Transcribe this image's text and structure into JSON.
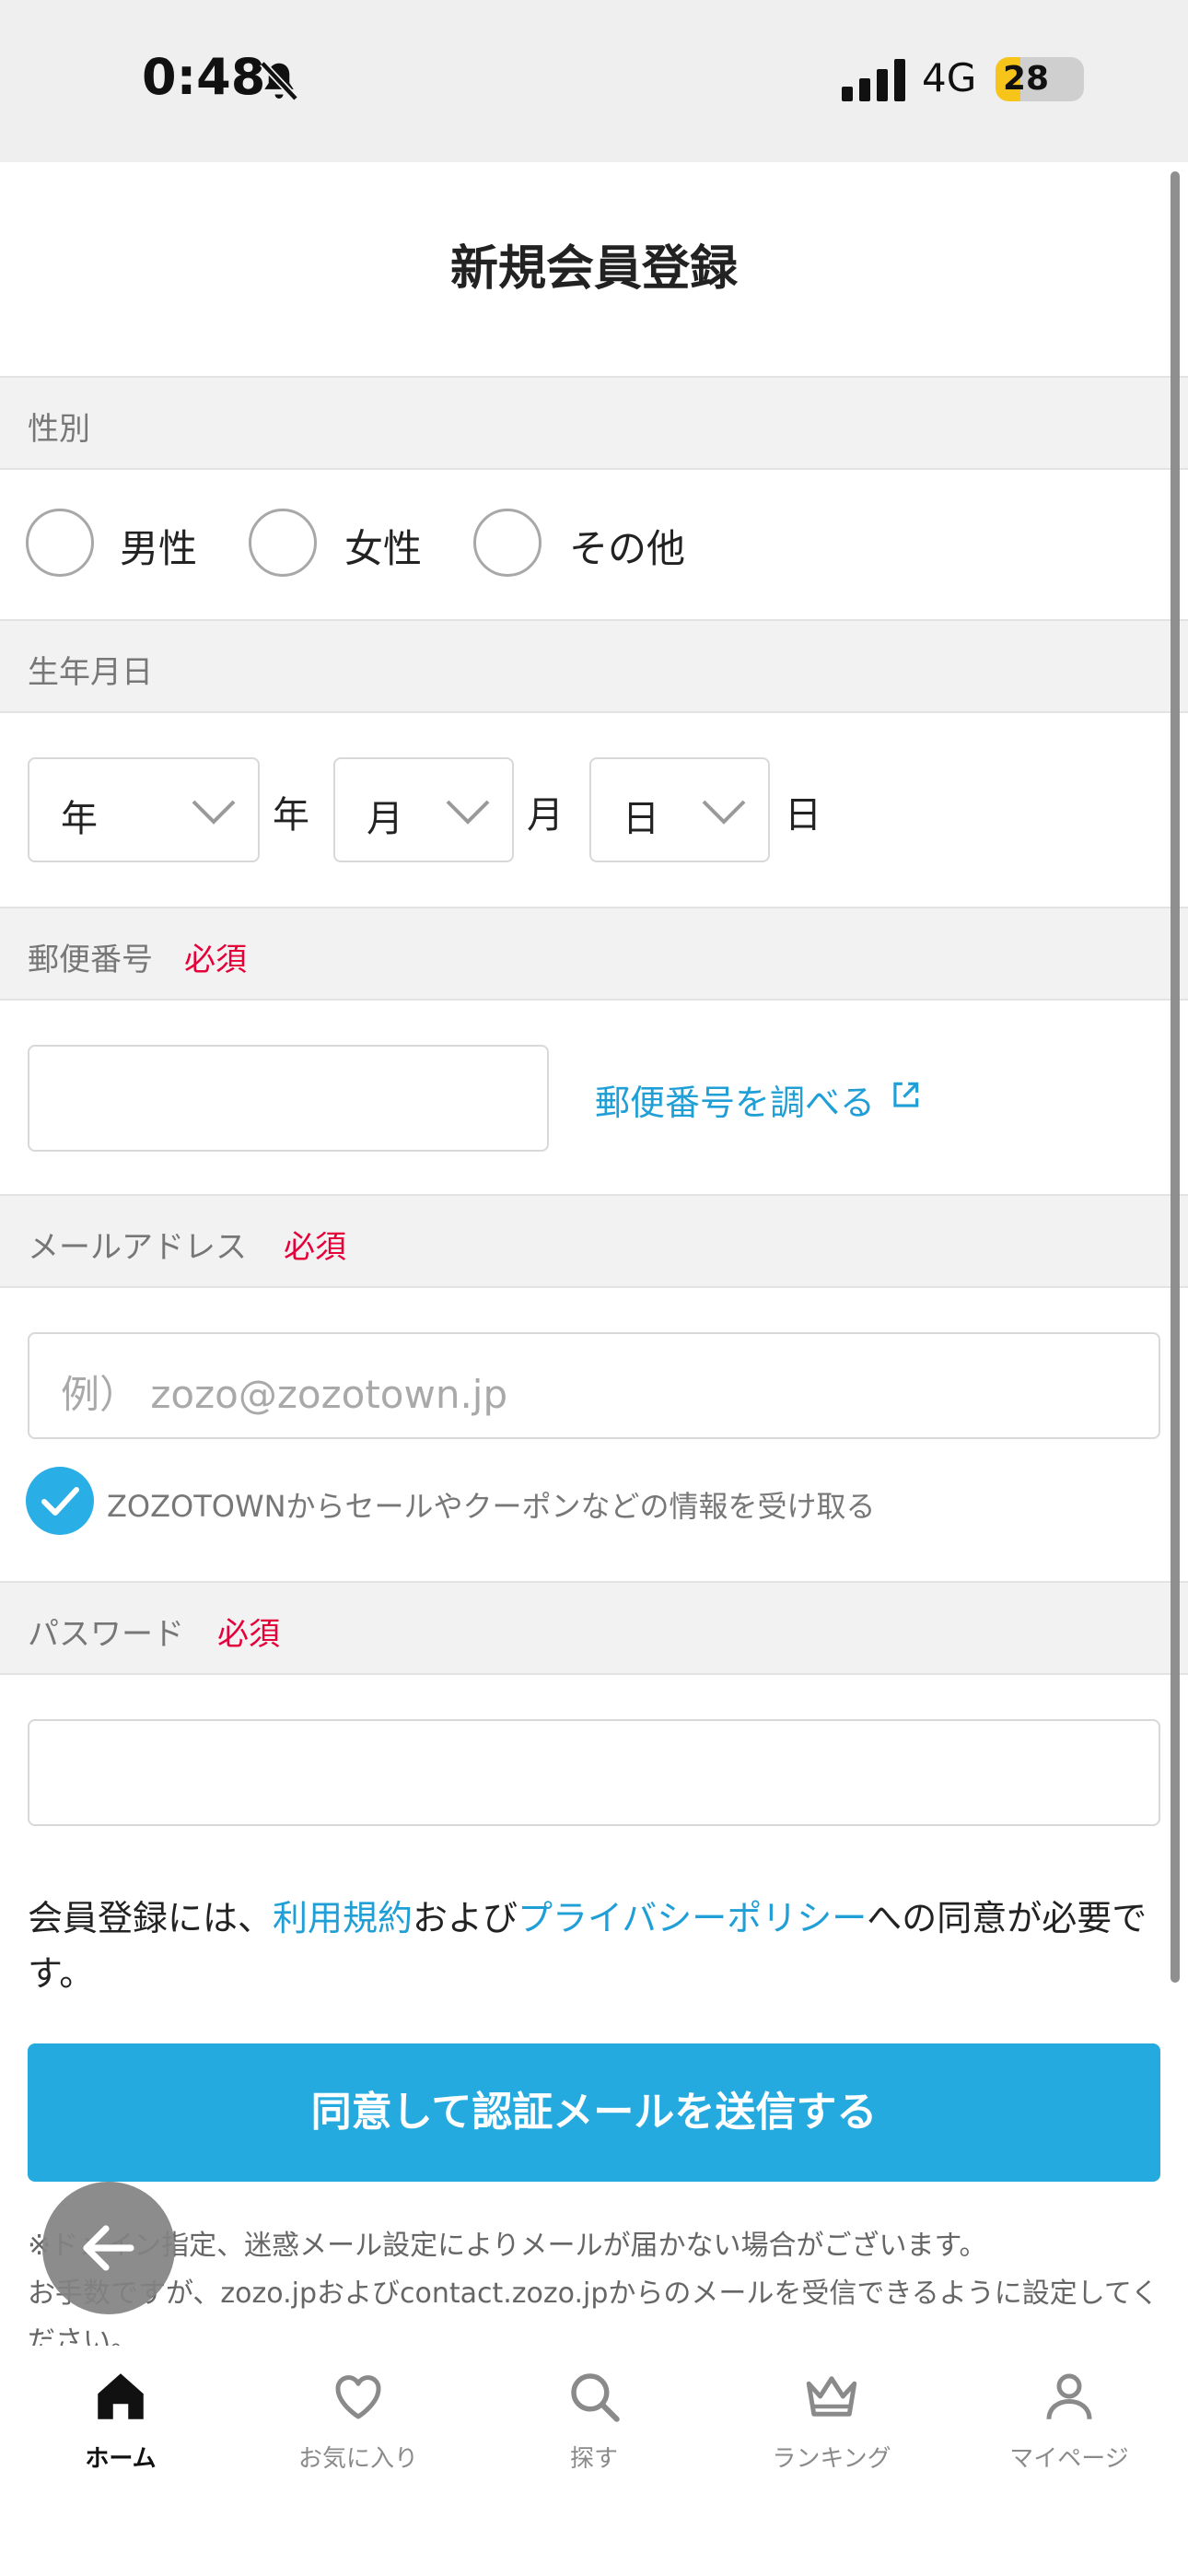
{
  "status_bar": {
    "time": "0:48",
    "network": "4G",
    "battery_level": "28",
    "battery_fraction": 0.28
  },
  "page": {
    "title": "新規会員登録"
  },
  "gender": {
    "label": "性別",
    "options": [
      "男性",
      "女性",
      "その他"
    ]
  },
  "birthday": {
    "label": "生年月日",
    "year": {
      "value": "年",
      "unit": "年"
    },
    "month": {
      "value": "月",
      "unit": "月"
    },
    "day": {
      "value": "日",
      "unit": "日"
    }
  },
  "postal_code": {
    "label": "郵便番号",
    "required": "必須",
    "value": "",
    "lookup_link": "郵便番号を調べる"
  },
  "email": {
    "label": "メールアドレス",
    "required": "必須",
    "placeholder": "例） zozo@zozotown.jp",
    "newsletter_label": "ZOZOTOWNからセールやクーポンなどの情報を受け取る",
    "newsletter_checked": true
  },
  "password": {
    "label": "パスワード",
    "required": "必須",
    "value": ""
  },
  "agreement": {
    "prefix": "会員登録には、",
    "terms_link": "利用規約",
    "and": "および",
    "privacy_link": "プライバシーポリシー",
    "suffix": "への同意が必要です。"
  },
  "submit_button": {
    "label": "同意して認証メールを送信する"
  },
  "note": {
    "line1": "※ドメイン指定、迷惑メール設定によりメールが届かない場合がございます。",
    "line2": "お手数ですが、zozo.jpおよびcontact.zozo.jpからのメールを受信できるように設定してください。"
  },
  "tab_bar": {
    "items": [
      {
        "label": "ホーム",
        "icon": "home-icon",
        "active": true
      },
      {
        "label": "お気に入り",
        "icon": "heart-icon",
        "active": false
      },
      {
        "label": "探す",
        "icon": "search-icon",
        "active": false
      },
      {
        "label": "ランキング",
        "icon": "crown-icon",
        "active": false
      },
      {
        "label": "マイページ",
        "icon": "person-icon",
        "active": false
      }
    ]
  },
  "colors": {
    "accent": "#25aae0",
    "link": "#1f9fd6",
    "required": "#e5003a",
    "section_bg": "#f2f2f2"
  }
}
